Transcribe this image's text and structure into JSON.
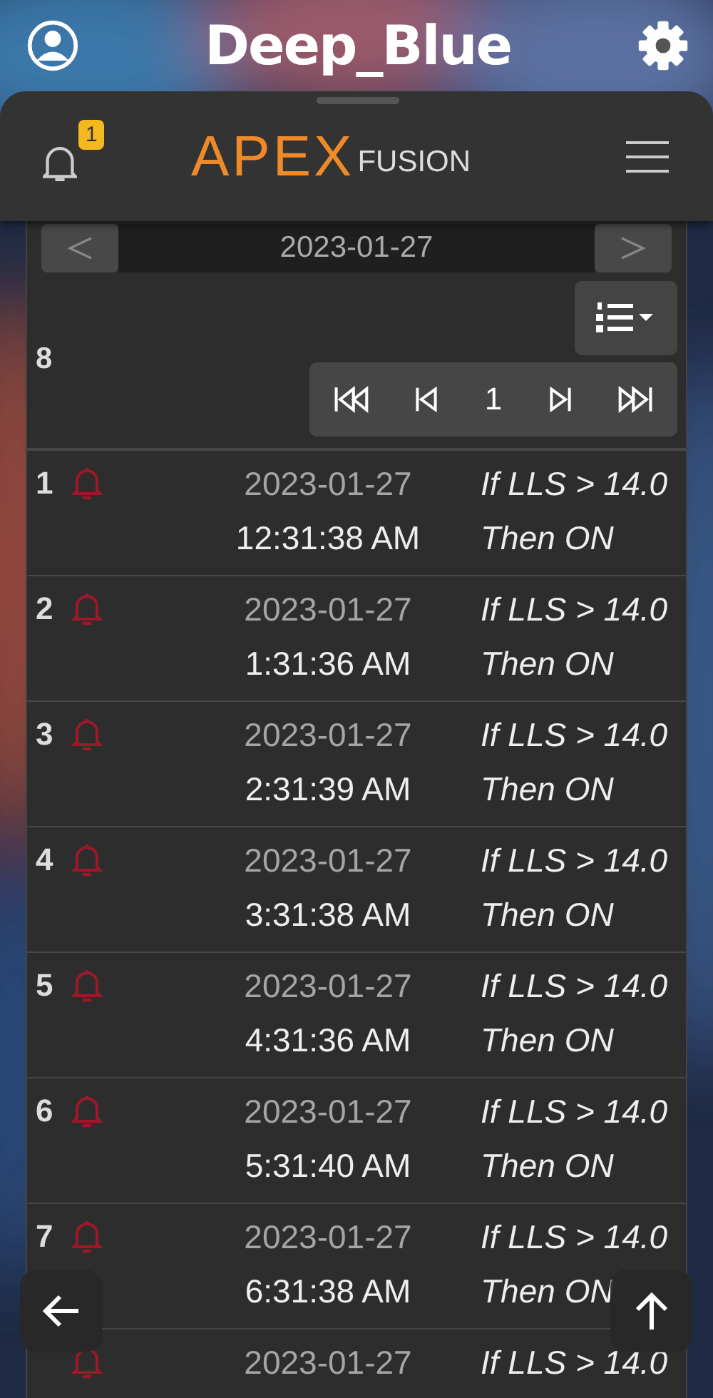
{
  "app_bar": {
    "title": "Deep_Blue"
  },
  "header": {
    "notification_count": "1",
    "logo_main": "APEX",
    "logo_sub": "FUSION"
  },
  "date_nav": {
    "date": "2023-01-27"
  },
  "log": {
    "count": "8",
    "page": "1"
  },
  "rows": [
    {
      "number": "1",
      "date": "2023-01-27",
      "time": "12:31:38 AM",
      "condition": "If LLS > 14.0",
      "action": "Then ON"
    },
    {
      "number": "2",
      "date": "2023-01-27",
      "time": "1:31:36 AM",
      "condition": "If LLS > 14.0",
      "action": "Then ON"
    },
    {
      "number": "3",
      "date": "2023-01-27",
      "time": "2:31:39 AM",
      "condition": "If LLS > 14.0",
      "action": "Then ON"
    },
    {
      "number": "4",
      "date": "2023-01-27",
      "time": "3:31:38 AM",
      "condition": "If LLS > 14.0",
      "action": "Then ON"
    },
    {
      "number": "5",
      "date": "2023-01-27",
      "time": "4:31:36 AM",
      "condition": "If LLS > 14.0",
      "action": "Then ON"
    },
    {
      "number": "6",
      "date": "2023-01-27",
      "time": "5:31:40 AM",
      "condition": "If LLS > 14.0",
      "action": "Then ON"
    },
    {
      "number": "7",
      "date": "2023-01-27",
      "time": "6:31:38 AM",
      "condition": "If LLS > 14.0",
      "action": "Then ON"
    },
    {
      "date": "2023-01-27",
      "condition": "If LLS > 14.0"
    }
  ]
}
